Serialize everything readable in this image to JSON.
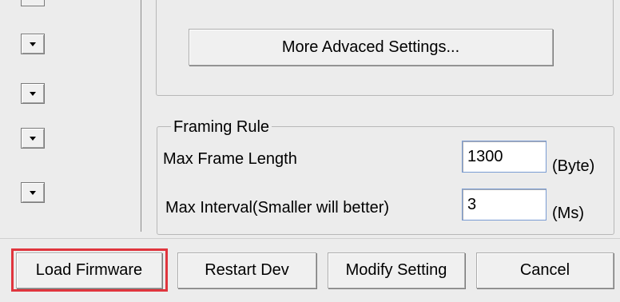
{
  "advanced": {
    "button_label": "More Advaced Settings..."
  },
  "framing": {
    "legend": "Framing Rule",
    "max_frame_length_label": "Max Frame Length",
    "max_frame_length_value": "1300",
    "max_frame_length_unit": "(Byte)",
    "max_interval_label": "Max Interval(Smaller will better)",
    "max_interval_value": "3",
    "max_interval_unit": "(Ms)"
  },
  "footer": {
    "load_firmware": "Load Firmware",
    "restart_dev": "Restart Dev",
    "modify_setting": "Modify Setting",
    "cancel": "Cancel"
  },
  "colors": {
    "highlight": "#e0353d",
    "panel": "#ececec"
  }
}
